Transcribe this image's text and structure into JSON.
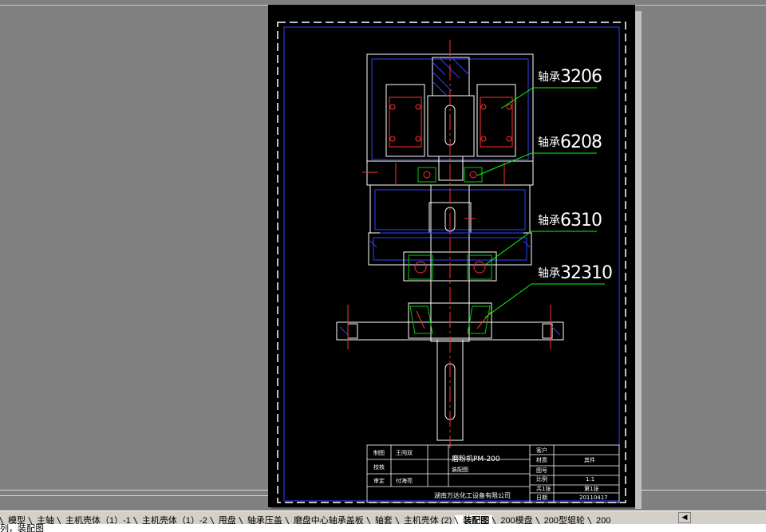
{
  "drawing": {
    "bearing_labels": [
      {
        "prefix": "轴承",
        "number": "3206"
      },
      {
        "prefix": "轴承",
        "number": "6208"
      },
      {
        "prefix": "轴承",
        "number": "6310"
      },
      {
        "prefix": "轴承",
        "number": "32310"
      }
    ],
    "title_block": {
      "designer_label": "制图",
      "designer_name": "王闯双",
      "checker_label": "校核",
      "approver_label": "审定",
      "approver_name": "付海亮",
      "drawing_name": "磨粉机PM-200",
      "drawing_subtitle": "装配图",
      "company": "湖南万达化工设备有限公司",
      "customer_label": "客户",
      "material_label": "材质",
      "material_value": "其件",
      "drawing_no_label": "图号",
      "scale_label": "比例",
      "scale_value": "1:1",
      "sheet_label": "共1张",
      "sheet_value": "第1张",
      "date_label": "日期",
      "date_value": "20110417"
    }
  },
  "tabs": [
    {
      "label": "模型",
      "active": false
    },
    {
      "label": "主轴",
      "active": false
    },
    {
      "label": "主机壳体（1）-1",
      "active": false
    },
    {
      "label": "主机壳体（1）-2",
      "active": false
    },
    {
      "label": "甩盘",
      "active": false
    },
    {
      "label": "轴承压盖",
      "active": false
    },
    {
      "label": "磨盘中心轴承盖板",
      "active": false
    },
    {
      "label": "轴套",
      "active": false
    },
    {
      "label": "主机壳体 (2)",
      "active": false
    },
    {
      "label": "装配图",
      "active": true
    },
    {
      "label": "200模盘",
      "active": false
    },
    {
      "label": "200型辊轮",
      "active": false
    },
    {
      "label": "200",
      "active": false
    }
  ],
  "command_line": "列，装配图",
  "colors": {
    "sheet": "#000000",
    "frame": "#0000ff",
    "outline": "#ffffff",
    "center": "#ff0000",
    "leader": "#00ff00",
    "bearing": "#ff0000",
    "hatch": "#0000ff"
  }
}
